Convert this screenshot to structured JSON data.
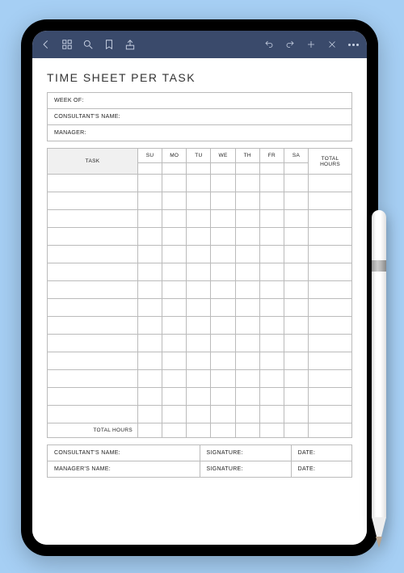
{
  "title": "TIME SHEET PER TASK",
  "header": {
    "week_of": "WEEK OF:",
    "consultants_name": "CONSULTANT'S NAME:",
    "manager": "MANAGER:"
  },
  "table": {
    "task_label": "TASK",
    "days": [
      "SU",
      "MO",
      "TU",
      "WE",
      "TH",
      "FR",
      "SA"
    ],
    "total_hours_label": "TOTAL\nHOURS",
    "total_hours_row": "TOTAL HOURS",
    "body_row_count": 14
  },
  "signatures": {
    "consultant_label": "CONSULTANT'S NAME:",
    "manager_label": "MANAGER'S NAME:",
    "signature_label": "SIGNATURE:",
    "date_label": "DATE:"
  }
}
